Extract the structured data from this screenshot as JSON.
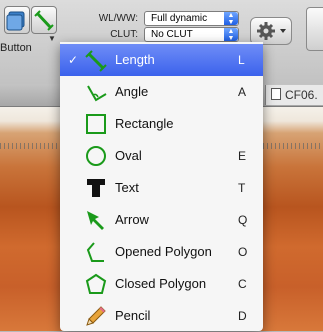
{
  "toolbar": {
    "button_label": "Button",
    "wlww_label": "WL/WW:",
    "wlww_value": "Full dynamic",
    "clut_label": "CLUT:",
    "clut_value": "No CLUT"
  },
  "tab": {
    "title": "CF06."
  },
  "menu": {
    "items": [
      {
        "label": "Length",
        "key": "L",
        "icon": "length-line-icon",
        "selected": true
      },
      {
        "label": "Angle",
        "key": "A",
        "icon": "angle-icon"
      },
      {
        "label": "Rectangle",
        "key": "",
        "icon": "rectangle-icon"
      },
      {
        "label": "Oval",
        "key": "E",
        "icon": "oval-icon"
      },
      {
        "label": "Text",
        "key": "T",
        "icon": "text-icon"
      },
      {
        "label": "Arrow",
        "key": "Q",
        "icon": "arrow-icon"
      },
      {
        "label": "Opened Polygon",
        "key": "O",
        "icon": "opened-polygon-icon"
      },
      {
        "label": "Closed Polygon",
        "key": "C",
        "icon": "closed-polygon-icon"
      },
      {
        "label": "Pencil",
        "key": "D",
        "icon": "pencil-icon"
      }
    ],
    "check_mark": "✓"
  },
  "colors": {
    "accent_green": "#1a9a1a",
    "selection_blue": "#3b62ec"
  }
}
